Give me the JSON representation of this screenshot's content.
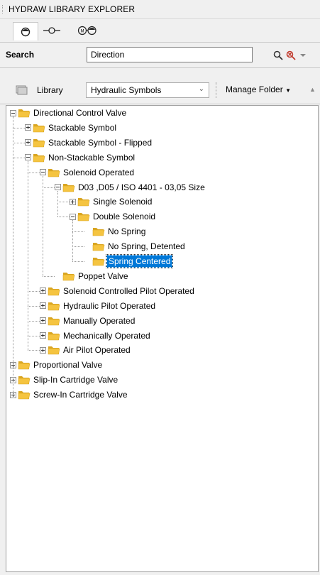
{
  "window": {
    "title": "HYDRAW LIBRARY EXPLORER"
  },
  "tabs": [
    {
      "name": "tab-symbols",
      "icon": "circle-half-icon"
    },
    {
      "name": "tab-connector",
      "icon": "line-connector-icon"
    },
    {
      "name": "tab-motor",
      "icon": "motor-pump-icon"
    }
  ],
  "search": {
    "label": "Search",
    "value": "Direction",
    "search_icon": "search-icon",
    "clear_icon": "clear-search-icon",
    "dropdown_icon": "chevron-down-icon"
  },
  "library": {
    "label": "Library",
    "icon": "library-icon",
    "selected": "Hydraulic Symbols",
    "manage_label": "Manage Folder"
  },
  "tree": [
    {
      "label": "Directional Control Valve",
      "level": 0,
      "expander": "minus"
    },
    {
      "label": "Stackable Symbol",
      "level": 1,
      "expander": "plus"
    },
    {
      "label": "Stackable Symbol - Flipped",
      "level": 1,
      "expander": "plus"
    },
    {
      "label": "Non-Stackable Symbol",
      "level": 1,
      "expander": "minus"
    },
    {
      "label": "Solenoid Operated",
      "level": 2,
      "expander": "minus"
    },
    {
      "label": "D03 ,D05 / ISO 4401 - 03,05 Size",
      "level": 3,
      "expander": "minus"
    },
    {
      "label": "Single Solenoid",
      "level": 4,
      "expander": "plus"
    },
    {
      "label": "Double Solenoid",
      "level": 4,
      "expander": "minus"
    },
    {
      "label": "No Spring",
      "level": 5,
      "expander": "none"
    },
    {
      "label": "No Spring, Detented",
      "level": 5,
      "expander": "none"
    },
    {
      "label": "Spring Centered",
      "level": 5,
      "expander": "none",
      "selected": true
    },
    {
      "label": "Poppet Valve",
      "level": 3,
      "expander": "none"
    },
    {
      "label": "Solenoid Controlled Pilot Operated",
      "level": 2,
      "expander": "plus"
    },
    {
      "label": "Hydraulic Pilot Operated",
      "level": 2,
      "expander": "plus"
    },
    {
      "label": "Manually Operated",
      "level": 2,
      "expander": "plus"
    },
    {
      "label": "Mechanically Operated",
      "level": 2,
      "expander": "plus"
    },
    {
      "label": "Air Pilot Operated",
      "level": 2,
      "expander": "plus"
    },
    {
      "label": "Proportional Valve",
      "level": 0,
      "expander": "plus"
    },
    {
      "label": "Slip-In Cartridge Valve",
      "level": 0,
      "expander": "plus"
    },
    {
      "label": "Screw-In Cartridge Valve",
      "level": 0,
      "expander": "plus"
    }
  ],
  "colors": {
    "selection": "#0078d7",
    "folder": "#f5c440",
    "folder_dark": "#d9a521"
  }
}
